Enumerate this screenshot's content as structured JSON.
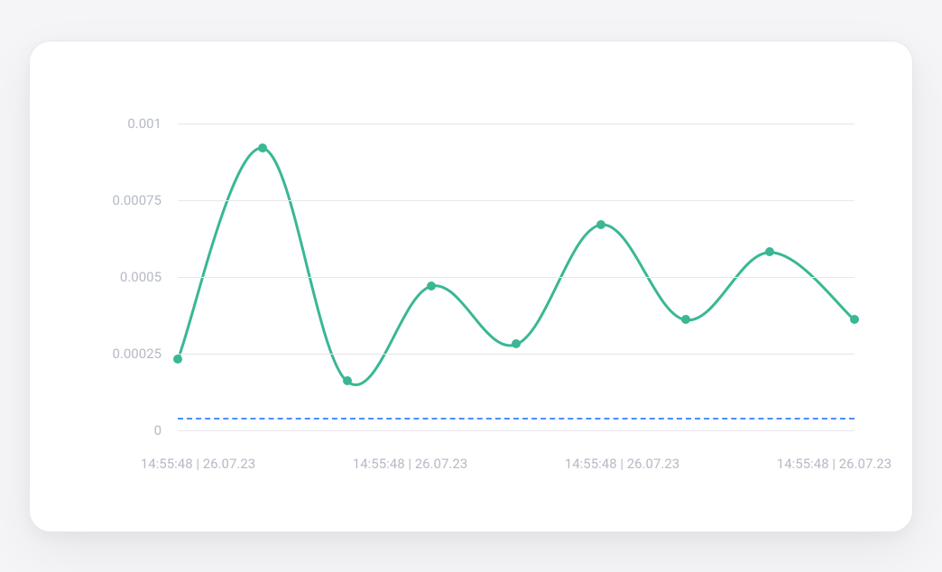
{
  "chart_data": {
    "type": "line",
    "ylim": [
      0,
      0.001
    ],
    "y_ticks": [
      0,
      0.00025,
      0.0005,
      0.00075,
      0.001
    ],
    "y_tick_labels": [
      "0",
      "0.00025",
      "0.0005",
      "0.00075",
      "0.001"
    ],
    "x_tick_labels": [
      "14:55:48 | 26.07.23",
      "14:55:48 | 26.07.23",
      "14:55:48 | 26.07.23",
      "14:55:48 | 26.07.23"
    ],
    "x": [
      0,
      1,
      2,
      3,
      4,
      5,
      6,
      7,
      8
    ],
    "values": [
      0.00023,
      0.00092,
      0.00016,
      0.00047,
      0.00028,
      0.00067,
      0.00036,
      0.00058,
      0.00036
    ],
    "threshold": 4e-05,
    "series_color": "#3ab795",
    "threshold_color": "#4a90f7"
  }
}
